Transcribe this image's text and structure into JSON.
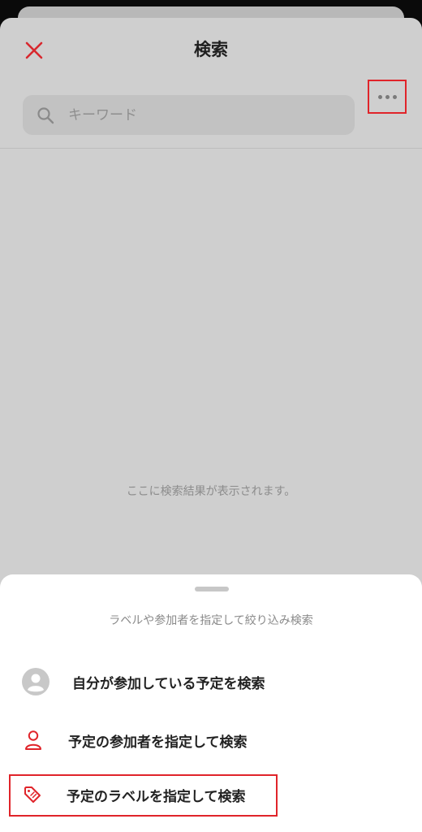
{
  "header": {
    "title": "検索",
    "close_icon": "close-icon"
  },
  "search": {
    "placeholder": "キーワード",
    "value": "",
    "icon": "search-icon",
    "more_icon": "more-horizontal-icon"
  },
  "main": {
    "empty_text": "ここに検索結果が表示されます。"
  },
  "sheet": {
    "caption": "ラベルや参加者を指定して絞り込み検索",
    "options": [
      {
        "label": "自分が参加している予定を検索",
        "icon": "user-avatar-icon"
      },
      {
        "label": "予定の参加者を指定して検索",
        "icon": "person-icon"
      },
      {
        "label": "予定のラベルを指定して検索",
        "icon": "tag-icon"
      }
    ]
  },
  "colors": {
    "accent": "#e0242a",
    "highlight_border": "#e0242a"
  }
}
